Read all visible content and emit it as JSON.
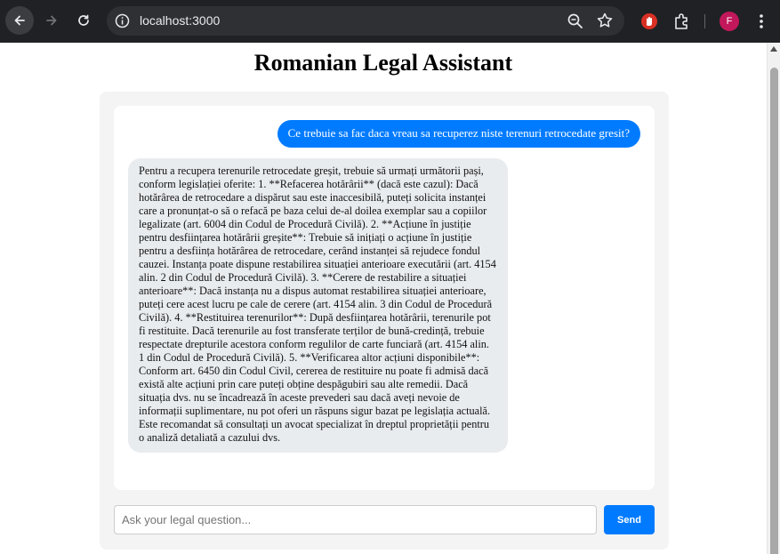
{
  "browser": {
    "url": "localhost:3000",
    "profile_initial": "F",
    "icons": [
      "back-icon",
      "forward-icon",
      "reload-icon",
      "site-info-icon",
      "zoom-icon",
      "star-icon",
      "extension-icon",
      "puzzle-icon",
      "menu-icon"
    ]
  },
  "page": {
    "title": "Romanian Legal Assistant"
  },
  "chat": {
    "user_message": "Ce trebuie sa fac daca vreau sa recuperez niste terenuri retrocedate gresit?",
    "assistant_message": "Pentru a recupera terenurile retrocedate greșit, trebuie să urmați următorii pași, conform legislației oferite: 1. **Refacerea hotărârii** (dacă este cazul): Dacă hotărârea de retrocedare a dispărut sau este inaccesibilă, puteți solicita instanței care a pronunțat-o să o refacă pe baza celui de-al doilea exemplar sau a copiilor legalizate (art. 6004 din Codul de Procedură Civilă). 2. **Acțiune în justiție pentru desființarea hotărârii greșite**: Trebuie să inițiați o acțiune în justiție pentru a desființa hotărârea de retrocedare, cerând instanței să rejudece fondul cauzei. Instanța poate dispune restabilirea situației anterioare executării (art. 4154 alin. 2 din Codul de Procedură Civilă). 3. **Cerere de restabilire a situației anterioare**: Dacă instanța nu a dispus automat restabilirea situației anterioare, puteți cere acest lucru pe cale de cerere (art. 4154 alin. 3 din Codul de Procedură Civilă). 4. **Restituirea terenurilor**: După desființarea hotărârii, terenurile pot fi restituite. Dacă terenurile au fost transferate terților de bună-credință, trebuie respectate drepturile acestora conform regulilor de carte funciară (art. 4154 alin. 1 din Codul de Procedură Civilă). 5. **Verificarea altor acțiuni disponibile**: Conform art. 6450 din Codul Civil, cererea de restituire nu poate fi admisă dacă există alte acțiuni prin care puteți obține despăgubiri sau alte remedii. Dacă situația dvs. nu se încadrează în aceste prevederi sau dacă aveți nevoie de informații suplimentare, nu pot oferi un răspuns sigur bazat pe legislația actuală. Este recomandat să consultați un avocat specializat în dreptul proprietății pentru o analiză detaliată a cazului dvs."
  },
  "input": {
    "placeholder": "Ask your legal question...",
    "value": "",
    "send_label": "Send"
  },
  "colors": {
    "accent": "#007bff",
    "bot_bubble": "#e9ecef",
    "panel": "#f4f4f4",
    "chrome": "#202124"
  }
}
